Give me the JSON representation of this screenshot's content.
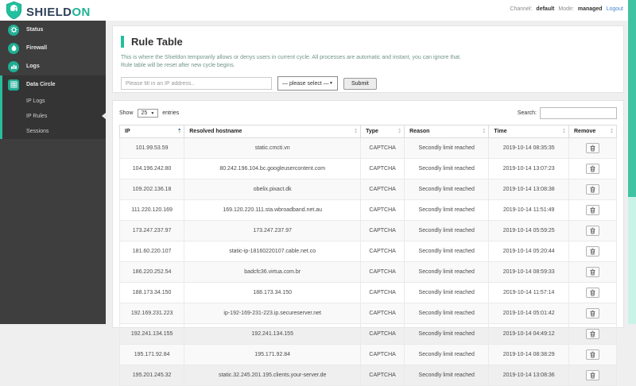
{
  "topbar": {
    "brand_shield": "SHIELD",
    "brand_on": "ON",
    "channel_label": "Channel:",
    "channel_value": "default",
    "mode_label": "Mode:",
    "mode_value": "managed",
    "logout_label": "Logout"
  },
  "sidebar": {
    "items": [
      {
        "label": "Status",
        "icon": "gear-icon"
      },
      {
        "label": "Firewall",
        "icon": "flame-icon"
      },
      {
        "label": "Logs",
        "icon": "bar-chart-icon"
      },
      {
        "label": "Data Circle",
        "icon": "grid-icon"
      }
    ],
    "subitems": [
      {
        "label": "IP Logs"
      },
      {
        "label": "IP Rules",
        "current": true
      },
      {
        "label": "Sessions"
      }
    ]
  },
  "page": {
    "title": "Rule Table",
    "description_line1": "This is where the Shieldon temporarily allows or denys users in current cycle. All processes are automatic and instant, you can ignore that.",
    "description_line2": "Rule table will be reset after new cycle begins.",
    "ip_input_placeholder": "Please fill in an IP address..",
    "select_placeholder": "— please select —",
    "submit_label": "Submit"
  },
  "table": {
    "show_label": "Show",
    "show_value": "25",
    "entries_label": "entries",
    "search_label": "Search:",
    "columns": [
      "IP",
      "Resolved hostname",
      "Type",
      "Reason",
      "Time",
      "Remove"
    ],
    "sorted_column": "IP",
    "rows": [
      {
        "ip": "101.99.53.59",
        "hostname": "static.cmcti.vn",
        "type": "CAPTCHA",
        "reason": "Secondly limit reached",
        "time": "2019-10-14 08:35:35"
      },
      {
        "ip": "104.196.242.80",
        "hostname": "80.242.196.104.bc.googleusercontent.com",
        "type": "CAPTCHA",
        "reason": "Secondly limit reached",
        "time": "2019-10-14 13:07:23"
      },
      {
        "ip": "109.202.136.18",
        "hostname": "obelix.pixact.dk",
        "type": "CAPTCHA",
        "reason": "Secondly limit reached",
        "time": "2019-10-14 13:08:38"
      },
      {
        "ip": "111.220.120.169",
        "hostname": "169.120.220.111.sta.wbroadband.net.au",
        "type": "CAPTCHA",
        "reason": "Secondly limit reached",
        "time": "2019-10-14 11:51:49"
      },
      {
        "ip": "173.247.237.97",
        "hostname": "173.247.237.97",
        "type": "CAPTCHA",
        "reason": "Secondly limit reached",
        "time": "2019-10-14 05:59:25"
      },
      {
        "ip": "181.60.220.107",
        "hostname": "static-ip-18160220107.cable.net.co",
        "type": "CAPTCHA",
        "reason": "Secondly limit reached",
        "time": "2019-10-14 05:20:44"
      },
      {
        "ip": "186.220.252.54",
        "hostname": "badcfc36.virtua.com.br",
        "type": "CAPTCHA",
        "reason": "Secondly limit reached",
        "time": "2019-10-14 08:59:33"
      },
      {
        "ip": "188.173.34.150",
        "hostname": "188.173.34.150",
        "type": "CAPTCHA",
        "reason": "Secondly limit reached",
        "time": "2019-10-14 11:57:14"
      },
      {
        "ip": "192.169.231.223",
        "hostname": "ip-192-169-231-223.ip.secureserver.net",
        "type": "CAPTCHA",
        "reason": "Secondly limit reached",
        "time": "2019-10-14 05:01:42"
      },
      {
        "ip": "192.241.134.155",
        "hostname": "192.241.134.155",
        "type": "CAPTCHA",
        "reason": "Secondly limit reached",
        "time": "2019-10-14 04:49:12"
      },
      {
        "ip": "195.171.92.84",
        "hostname": "195.171.92.84",
        "type": "CAPTCHA",
        "reason": "Secondly limit reached",
        "time": "2019-10-14 08:38:29"
      },
      {
        "ip": "195.201.245.32",
        "hostname": "static.32.245.201.195.clients.your-server.de",
        "type": "CAPTCHA",
        "reason": "Secondly limit reached",
        "time": "2019-10-14 13:08:36"
      }
    ]
  },
  "colors": {
    "accent_teal": "#26bf9d",
    "sidebar_bg": "#3e3e3e",
    "scrollbar_thumb": "#3fc3a3",
    "scrollbar_track": "#c9f3e6",
    "logout_link": "#4a87d6",
    "brand_dark": "#31425a"
  }
}
